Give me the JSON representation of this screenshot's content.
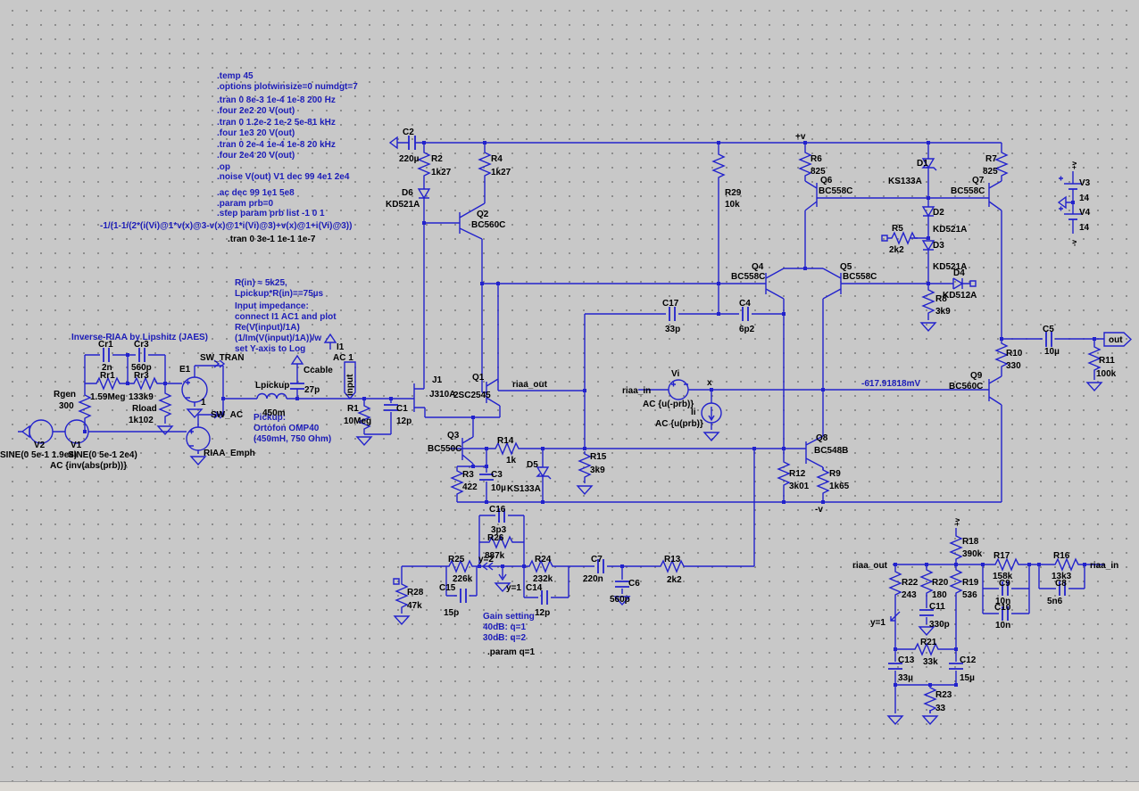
{
  "directives": {
    "d1": ".temp 45",
    "d2": ".options plotwinsize=0 numdgt=7",
    "d3": ".tran 0 8e-3 1e-4 1e-8   200 Hz",
    "d4": ".four 2e2 20 V(out)",
    "d5": ".tran 0 1.2e-2 1e-2 5e-81 kHz",
    "d6": ".four 1e3 20 V(out)",
    "d7": ".tran 0 2e-4 1e-4 1e-8   20 kHz",
    "d8": ".four 2e4 20 V(out)",
    "d9": ".op",
    "d10": ".noise V(out) V1 dec 99 4e1 2e4",
    "d11": ".ac dec 99 1e1 5e8",
    "d12": ".param prb=0",
    "d13": ".step param prb list -1 0 1",
    "formula": "-1/(1-1/(2*(i(Vi)@1*v(x)@3-v(x)@1*i(Vi)@3)+v(x)@1+i(Vi)@3))",
    "tran_extra": ".tran 0 3e-1 1e-1 1e-7",
    "param_q": ".param q=1"
  },
  "comments": {
    "title": "Inverse-RIAA by Lipshitz (JAES)",
    "rin1": "R(in) ≈ 5k25,",
    "rin2": "Lpickup*R(in)==75µs",
    "imp1": "Input impedance:",
    "imp2": "connect I1 AC1 and plot",
    "imp3": "Re(V(input)/1A)",
    "imp4": "(1/Im(V(input)/1A))/w",
    "imp5": "set Y-axis to Log",
    "pickup1": "Pickup:",
    "pickup2": "Ortofon OMP40",
    "pickup3": "(450mH, 750 Ohm)",
    "gain1": "Gain setting",
    "gain2": "40dB: q=1",
    "gain3": "30dB: q=2",
    "bias": "-617.91818mV"
  },
  "nets": {
    "input": "input",
    "out": "out",
    "x": "x",
    "riaa_out": "riaa_out",
    "riaa_in": "riaa_in",
    "plus_v": "+v",
    "minus_v": "-v",
    "sw_tran": "SW_TRAN",
    "sw_ac": "SW_AC",
    "y1": "y=1",
    "y2": "y=2"
  },
  "parts": {
    "C2": {
      "r": "C2",
      "v": "220µ"
    },
    "R2": {
      "r": "R2",
      "v": "1k27"
    },
    "R4": {
      "r": "R4",
      "v": "1k27"
    },
    "D6": {
      "r": "D6",
      "v": "KD521A"
    },
    "Q2": {
      "r": "Q2",
      "v": "BC560C"
    },
    "R29": {
      "r": "R29",
      "v": "10k"
    },
    "R6": {
      "r": "R6",
      "v": "825"
    },
    "Q6": {
      "r": "Q6",
      "v": "BC558C"
    },
    "D1": {
      "r": "D1",
      "v": "KS133A"
    },
    "R7": {
      "r": "R7",
      "v": "825"
    },
    "Q7": {
      "r": "Q7",
      "v": "BC558C"
    },
    "D2": {
      "r": "D2",
      "v": "KD521A"
    },
    "R5": {
      "r": "R5",
      "v": "2k2"
    },
    "D3": {
      "r": "D3",
      "v": "KD521A"
    },
    "D4": {
      "r": "D4",
      "v": "KD512A"
    },
    "R8": {
      "r": "R8",
      "v": "3k9"
    },
    "Q4": {
      "r": "Q4",
      "v": "BC558C"
    },
    "Q5": {
      "r": "Q5",
      "v": "BC558C"
    },
    "C17": {
      "r": "C17",
      "v": "33p"
    },
    "C4": {
      "r": "C4",
      "v": "6p2"
    },
    "V3": {
      "r": "V3",
      "v": "14"
    },
    "V4": {
      "r": "V4",
      "v": "14"
    },
    "R10": {
      "r": "R10",
      "v": "330"
    },
    "C5": {
      "r": "C5",
      "v": "10µ"
    },
    "R11": {
      "r": "R11",
      "v": "100k"
    },
    "Q9": {
      "r": "Q9",
      "v": "BC560C"
    },
    "Vi": {
      "r": "Vi",
      "v": "AC {u(-prb)}"
    },
    "Ii": {
      "r": "Ii",
      "v": "AC {u(prb)}"
    },
    "Q8": {
      "r": "Q8",
      "v": "BC548B"
    },
    "R12": {
      "r": "R12",
      "v": "3k01"
    },
    "R9": {
      "r": "R9",
      "v": "1k65"
    },
    "J1": {
      "r": "J1",
      "v": "J310A"
    },
    "Q1": {
      "r": "Q1",
      "v": "2SC2545"
    },
    "R1": {
      "r": "R1",
      "v": "10Meg"
    },
    "C1": {
      "r": "C1",
      "v": "12p"
    },
    "Q3": {
      "r": "Q3",
      "v": "BC550C"
    },
    "R3": {
      "r": "R3",
      "v": "422"
    },
    "C3": {
      "r": "C3",
      "v": "10µ"
    },
    "R14": {
      "r": "R14",
      "v": "1k"
    },
    "D5": {
      "r": "D5",
      "v": "KS133A"
    },
    "R15": {
      "r": "R15",
      "v": "3k9"
    },
    "C16": {
      "r": "C16",
      "v": "3p3"
    },
    "R26": {
      "r": "R26",
      "v": "887k"
    },
    "R25": {
      "r": "R25",
      "v": "226k"
    },
    "C15": {
      "r": "C15",
      "v": "15p"
    },
    "R24": {
      "r": "R24",
      "v": "232k"
    },
    "C14": {
      "r": "C14",
      "v": "12p"
    },
    "C7": {
      "r": "C7",
      "v": "220n"
    },
    "C6": {
      "r": "C6",
      "v": "560p"
    },
    "R13": {
      "r": "R13",
      "v": "2k2"
    },
    "R28": {
      "r": "R28",
      "v": "47k"
    },
    "Cr1": {
      "r": "Cr1",
      "v": "2n"
    },
    "Rr1": {
      "r": "Rr1",
      "v": "1.59Meg"
    },
    "Cr3": {
      "r": "Cr3",
      "v": "560p"
    },
    "Rr3": {
      "r": "Rr3",
      "v": "133k9"
    },
    "Rgen": {
      "r": "Rgen",
      "v": "300"
    },
    "Rload": {
      "r": "Rload",
      "v": "1k102"
    },
    "E1": {
      "r": "E1",
      "v": "1"
    },
    "ER": {
      "r": "RIAA_Emph"
    },
    "V2": {
      "r": "V2",
      "v": "SINE(0 5e-1 1.9e4)"
    },
    "V1": {
      "r": "V1",
      "v": "SINE(0 5e-1 2e4)",
      "v2": "AC {inv(abs(prb))}"
    },
    "Lp": {
      "r": "Lpickup",
      "v": "450m"
    },
    "Cc": {
      "r": "Ccable",
      "v": "27p"
    },
    "I1": {
      "r": "I1",
      "v": "AC 1"
    },
    "R18": {
      "r": "R18",
      "v": "390k"
    },
    "R17": {
      "r": "R17",
      "v": "158k"
    },
    "R16": {
      "r": "R16",
      "v": "13k3"
    },
    "C9": {
      "r": "C9",
      "v": "10n"
    },
    "C10": {
      "r": "C10",
      "v": "10n"
    },
    "C8": {
      "r": "C8",
      "v": "5n6"
    },
    "R22": {
      "r": "R22",
      "v": "243"
    },
    "R20": {
      "r": "R20",
      "v": "180"
    },
    "R19": {
      "r": "R19",
      "v": "536"
    },
    "C11": {
      "r": "C11",
      "v": "330p"
    },
    "R21": {
      "r": "R21",
      "v": "33k"
    },
    "C13": {
      "r": "C13",
      "v": "33µ"
    },
    "C12": {
      "r": "C12",
      "v": "15µ"
    },
    "R23": {
      "r": "R23",
      "v": "33"
    }
  }
}
